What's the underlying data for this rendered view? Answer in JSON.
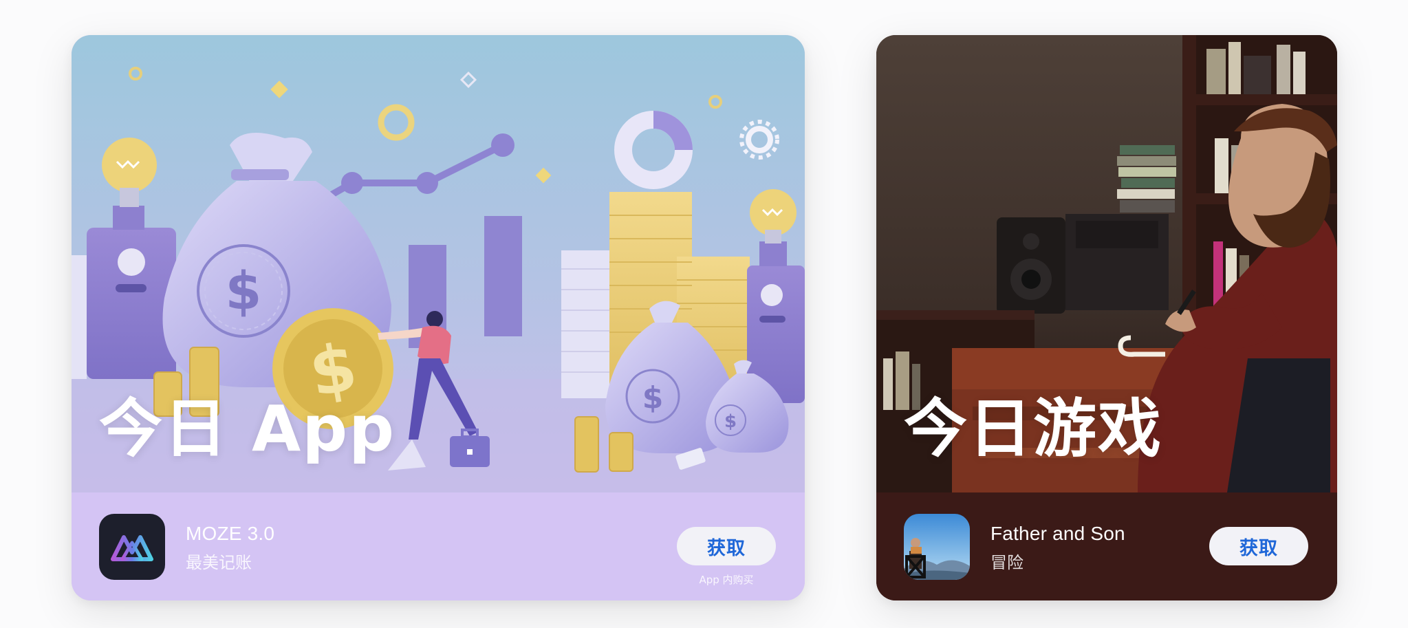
{
  "cards": [
    {
      "title": "今日 App",
      "app": {
        "name": "MOZE 3.0",
        "subtitle": "最美记账",
        "button_label": "获取",
        "iap_note": "App 内购买",
        "icon": "moze-logo-icon"
      },
      "colors": {
        "hero_top": "#9fc6dc",
        "hero_bottom": "#c9c0ea",
        "footer": "#d4c4f4",
        "button_text": "#1f67d8"
      }
    },
    {
      "title": "今日游戏",
      "app": {
        "name": "Father and Son",
        "subtitle": "冒险",
        "button_label": "获取",
        "icon": "father-and-son-icon"
      },
      "colors": {
        "hero_bg": "#4a3a33",
        "footer": "#3b1a17",
        "button_text": "#1f67d8"
      }
    }
  ]
}
